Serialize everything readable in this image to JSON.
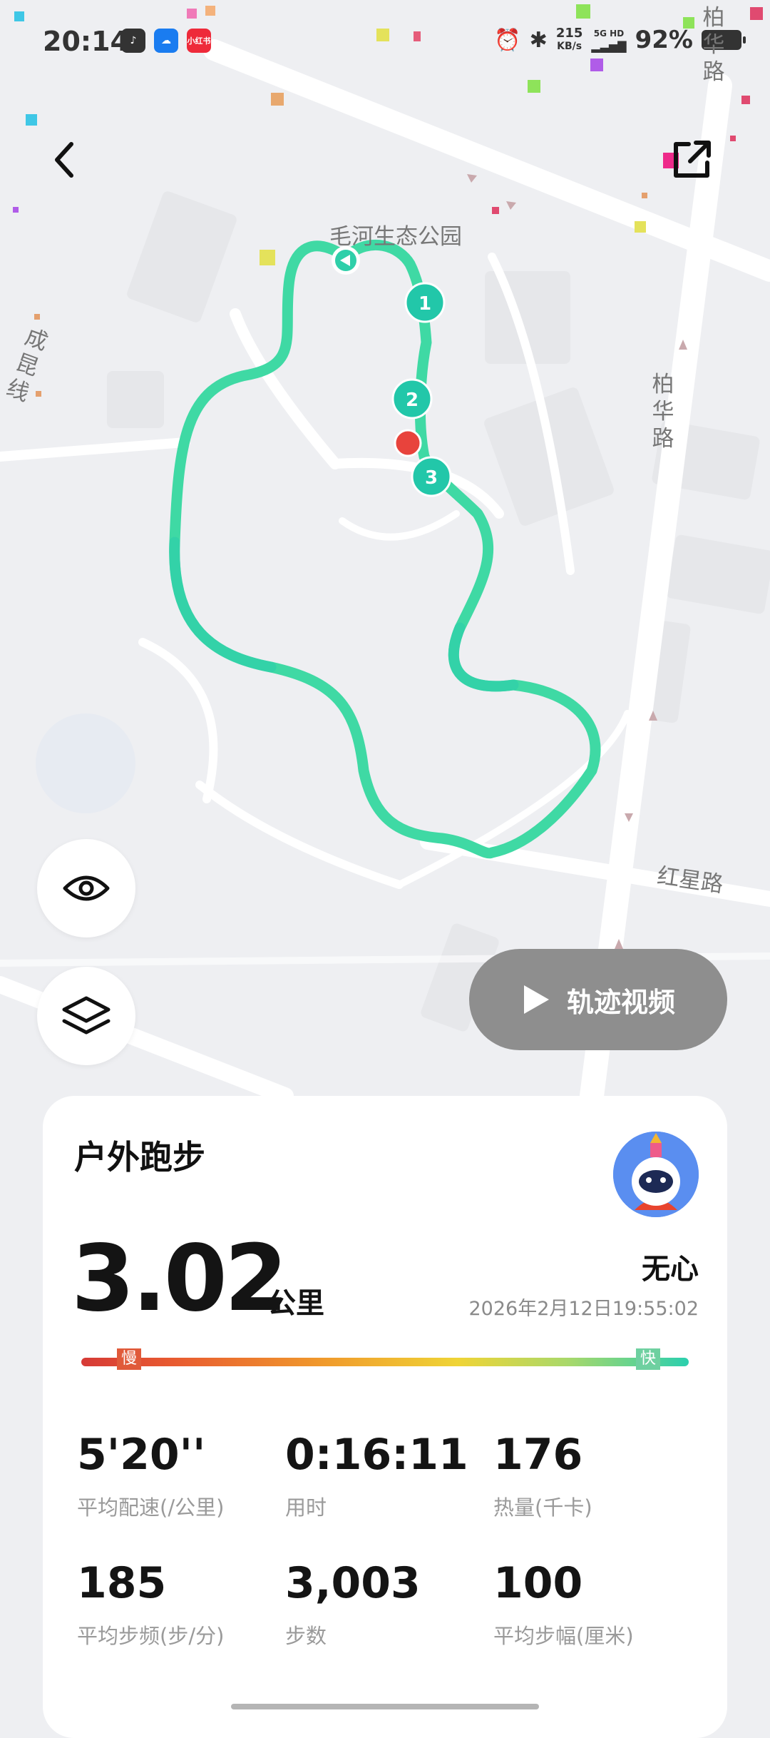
{
  "status_bar": {
    "time": "20:14",
    "apps": [
      {
        "icon": "tiktok-icon",
        "color": "#333333",
        "label": ""
      },
      {
        "icon": "cloud-app-icon",
        "color": "#1a7cf0",
        "label": ""
      },
      {
        "icon": "xiaohongshu-icon",
        "color": "#ee2a3a",
        "label": "小红书"
      }
    ],
    "net_speed": "215",
    "net_unit": "KB/s",
    "net_type": "5G HD",
    "battery": "92%"
  },
  "map": {
    "labels": {
      "park": "毛河生态公园",
      "road_cheng": "成昆线",
      "road_bai_top": "柏华路",
      "road_bai": "柏华路",
      "road_hong": "红星路"
    },
    "markers": [
      "1",
      "2",
      "3"
    ],
    "route_color": "#3fd9a4"
  },
  "controls": {
    "back_icon": "back-arrow-icon",
    "share_icon": "share-external-icon",
    "eye_icon": "eye-icon",
    "layers_icon": "layers-icon",
    "video_label": "轨迹视频"
  },
  "summary": {
    "title": "户外跑步",
    "distance": "3.02",
    "unit": "公里",
    "user": "无心",
    "datetime": "2026年2月12日19:55:02",
    "pace_slow": "慢",
    "pace_fast": "快",
    "stats": [
      {
        "value": "5'20''",
        "label": "平均配速(/公里)"
      },
      {
        "value": "0:16:11",
        "label": "用时"
      },
      {
        "value": "176",
        "label": "热量(千卡)"
      },
      {
        "value": "185",
        "label": "平均步频(步/分)"
      },
      {
        "value": "3,003",
        "label": "步数"
      },
      {
        "value": "100",
        "label": "平均步幅(厘米)"
      }
    ]
  }
}
